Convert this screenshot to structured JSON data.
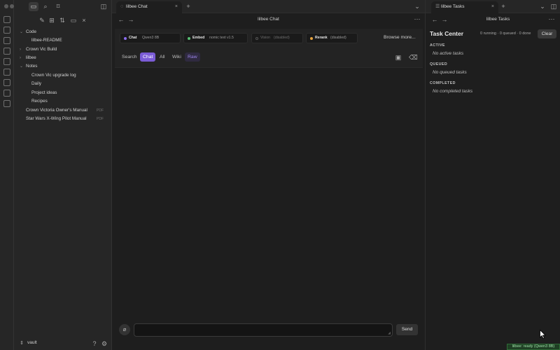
{
  "colors": {
    "accent": "#7b5cd6",
    "chat_dot": "#8b6cf0",
    "embed_dot": "#58c073",
    "rerank_dot": "#e6a23c",
    "vision_dot": "#555555",
    "status_bg": "#1f3f24"
  },
  "sidebar": {
    "tree": [
      {
        "label": "Code",
        "kind": "folder",
        "expanded": true
      },
      {
        "label": "lilbee-README",
        "kind": "file"
      },
      {
        "label": "Crown Vic Build",
        "kind": "folder",
        "expanded": false
      },
      {
        "label": "lilbee",
        "kind": "folder",
        "expanded": false
      },
      {
        "label": "Notes",
        "kind": "folder",
        "expanded": true
      },
      {
        "label": "Crown Vic upgrade log",
        "kind": "file"
      },
      {
        "label": "Daily",
        "kind": "file"
      },
      {
        "label": "Project ideas",
        "kind": "file"
      },
      {
        "label": "Recipes",
        "kind": "file"
      },
      {
        "label": "Crown Victoria Owner's Manual",
        "kind": "file",
        "badge": "PDF"
      },
      {
        "label": "Star Wars X-Wing Pilot Manual",
        "kind": "file",
        "badge": "PDF"
      }
    ],
    "vault": "vault"
  },
  "tabs": {
    "left": {
      "label": "lilbee Chat"
    },
    "right": {
      "label": "lilbee Tasks"
    }
  },
  "chat": {
    "header": "lilbee Chat",
    "models": {
      "chat": {
        "key": "Chat",
        "value": "Qwen3 8B"
      },
      "embed": {
        "key": "Embed",
        "value": "nomic text v1.5"
      },
      "vision": {
        "key": "Vision",
        "value": "(disabled)"
      },
      "rerank": {
        "key": "Rerank",
        "value": "(disabled)"
      },
      "browse": "Browse more..."
    },
    "modes": {
      "search": "Search",
      "chat": "Chat",
      "all": "All",
      "wiki": "Wiki",
      "raw": "Raw",
      "active": "Chat"
    },
    "send": "Send"
  },
  "tasks": {
    "header": "lilbee Tasks",
    "title": "Task Center",
    "counts": "0 running · 0 queued · 0 done",
    "clear": "Clear",
    "sections": [
      {
        "heading": "ACTIVE",
        "empty": "No active tasks"
      },
      {
        "heading": "QUEUED",
        "empty": "No queued tasks"
      },
      {
        "heading": "COMPLETED",
        "empty": "No completed tasks"
      }
    ]
  },
  "status": "lilbee: ready (Qwen3 8B)"
}
